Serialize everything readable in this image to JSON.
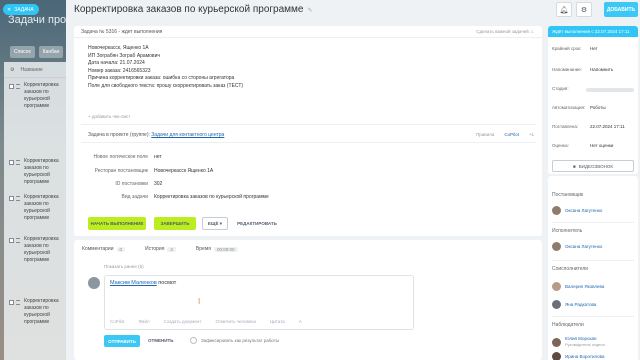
{
  "background": {
    "title": "Задачи проекта",
    "tabs": [
      "Список",
      "Канбан"
    ],
    "column_name": "Название",
    "rows": [
      "Корректировка заказов по курьерской программе",
      "Корректировка заказов по курьерской программе",
      "Корректировка заказов по курьерской программе",
      "Корректировка заказов по курьерской программе",
      "Корректировка заказов по курьерской программе"
    ]
  },
  "close_pill": {
    "label": "ЗАДАЧА"
  },
  "header": {
    "title": "Корректировка заказов по курьерской программе",
    "add_label": "ДОБАВИТЬ"
  },
  "task": {
    "number_status": "Задача № 5316 - ждет выполнения",
    "importance": "Сделать важной задачей",
    "description": [
      "Новочеркасск, Ященко 1А",
      "ИП Зограбян Зограб Арамович",
      "Дата начала: 21.07.2024",
      "Номер заказа: 2416565323",
      "Причина корректировки заказа: ошибка со стороны агрегатора",
      "Поле для свободного текста: прошу скорректировать заказ (ТЕСТ)"
    ],
    "add_checklist": "+ добавить чек-лист",
    "project_prefix": "Задача в проекте (группе):",
    "project_name": "Задачи для контактного центра",
    "right_links": [
      "Правила",
      "CoPilot",
      "+1"
    ],
    "props": [
      {
        "label": "Новое логическое поле",
        "value": "нет"
      },
      {
        "label": "Ресторан постановщик",
        "value": "Новочеркасск Ященко 1А"
      },
      {
        "label": "ID постановки",
        "value": "302"
      },
      {
        "label": "Вид задачи",
        "value": "Корректировка заказов по курьерской программе"
      }
    ],
    "buttons": {
      "start": "НАЧАТЬ ВЫПОЛНЕНИЕ",
      "finish": "ЗАВЕРШИТЬ",
      "more": "ЕЩЁ",
      "edit": "РЕДАКТИРОВАТЬ"
    }
  },
  "comments": {
    "tabs": [
      {
        "label": "Комментарии",
        "count": "0"
      },
      {
        "label": "История",
        "count": "2"
      },
      {
        "label": "Время",
        "count": "00:00:00"
      }
    ],
    "show_more": "Показать ранее (5)",
    "mention_name": "Максим Маленков",
    "mention_text": "посмот",
    "tools": [
      "CoPilot",
      "Файл",
      "Создать документ",
      "Отметить человека",
      "Цитата"
    ],
    "send": "ОТПРАВИТЬ",
    "cancel": "ОТМЕНИТЬ",
    "result": "Зафиксировать как результат работы"
  },
  "sidebar": {
    "status": "Ждёт выполнения с 22.07.2024 17:11",
    "rows": [
      {
        "label": "Крайний срок:",
        "value": "Нет"
      },
      {
        "label": "Напоминание:",
        "value": "Напомнить"
      },
      {
        "label": "Стадия:",
        "value": ""
      },
      {
        "label": "Автоматизация:",
        "value": "Роботы"
      },
      {
        "label": "Поставлена:",
        "value": "22.07.2024 17:11"
      },
      {
        "label": "Оценка:",
        "value": "Нет оценки"
      }
    ],
    "video_call": "ВИДЕОЗВОНОК",
    "poster_heading": "Постановщик",
    "poster": "Оксана Лагутенко",
    "assignee_heading": "Исполнитель",
    "assignee": "Оксана Лагутенко",
    "coassignee_heading": "Соисполнители",
    "coassignees": [
      "Валерия Яковлева",
      "Яна Радкатова"
    ],
    "observers_heading": "Наблюдатели",
    "observers": [
      {
        "name": "Юлия Морозан",
        "role": "Руководитель отдела"
      },
      {
        "name": "Ирина Воротилова",
        "role": ""
      }
    ]
  }
}
